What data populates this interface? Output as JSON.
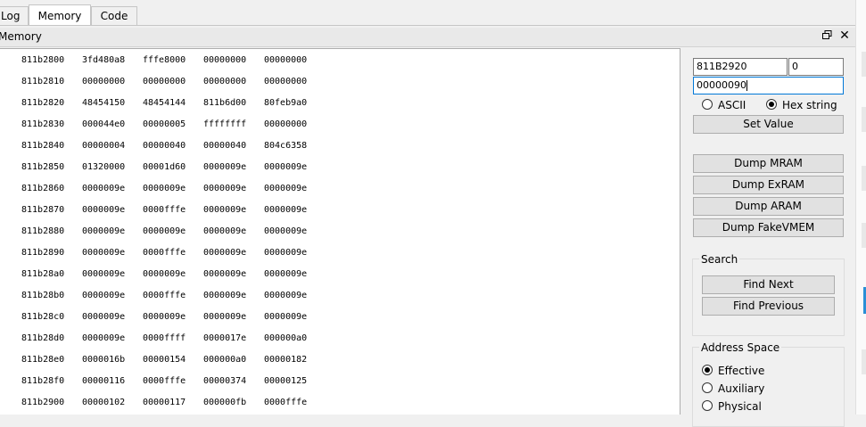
{
  "tabs": [
    {
      "label": "Log"
    },
    {
      "label": "Memory"
    },
    {
      "label": "Code"
    }
  ],
  "memory_panel": {
    "title": "Memory",
    "float_icon": "float-window-icon",
    "close_icon": "close-icon"
  },
  "hex_rows": [
    {
      "addr": "811b2800",
      "w": [
        "3fd480a8",
        "fffe8000",
        "00000000",
        "00000000"
      ]
    },
    {
      "addr": "811b2810",
      "w": [
        "00000000",
        "00000000",
        "00000000",
        "00000000"
      ]
    },
    {
      "addr": "811b2820",
      "w": [
        "48454150",
        "48454144",
        "811b6d00",
        "80feb9a0"
      ]
    },
    {
      "addr": "811b2830",
      "w": [
        "000044e0",
        "00000005",
        "ffffffff",
        "00000000"
      ]
    },
    {
      "addr": "811b2840",
      "w": [
        "00000004",
        "00000040",
        "00000040",
        "804c6358"
      ]
    },
    {
      "addr": "811b2850",
      "w": [
        "01320000",
        "00001d60",
        "0000009e",
        "0000009e"
      ]
    },
    {
      "addr": "811b2860",
      "w": [
        "0000009e",
        "0000009e",
        "0000009e",
        "0000009e"
      ]
    },
    {
      "addr": "811b2870",
      "w": [
        "0000009e",
        "0000fffe",
        "0000009e",
        "0000009e"
      ]
    },
    {
      "addr": "811b2880",
      "w": [
        "0000009e",
        "0000009e",
        "0000009e",
        "0000009e"
      ]
    },
    {
      "addr": "811b2890",
      "w": [
        "0000009e",
        "0000fffe",
        "0000009e",
        "0000009e"
      ]
    },
    {
      "addr": "811b28a0",
      "w": [
        "0000009e",
        "0000009e",
        "0000009e",
        "0000009e"
      ]
    },
    {
      "addr": "811b28b0",
      "w": [
        "0000009e",
        "0000fffe",
        "0000009e",
        "0000009e"
      ]
    },
    {
      "addr": "811b28c0",
      "w": [
        "0000009e",
        "0000009e",
        "0000009e",
        "0000009e"
      ]
    },
    {
      "addr": "811b28d0",
      "w": [
        "0000009e",
        "0000ffff",
        "0000017e",
        "000000a0"
      ]
    },
    {
      "addr": "811b28e0",
      "w": [
        "0000016b",
        "00000154",
        "000000a0",
        "00000182"
      ]
    },
    {
      "addr": "811b28f0",
      "w": [
        "00000116",
        "0000fffe",
        "00000374",
        "00000125"
      ]
    },
    {
      "addr": "811b2900",
      "w": [
        "00000102",
        "00000117",
        "000000fb",
        "0000fffe"
      ]
    }
  ],
  "controls": {
    "address_value": "811B2920",
    "length_value": "0",
    "value_input": "00000090",
    "radio_ascii": "ASCII",
    "radio_hex": "Hex string",
    "hex_selected": true,
    "set_value": "Set Value",
    "dump_mram": "Dump MRAM",
    "dump_exram": "Dump ExRAM",
    "dump_aram": "Dump ARAM",
    "dump_fakevmem": "Dump FakeVMEM"
  },
  "search": {
    "label": "Search",
    "find_next": "Find Next",
    "find_previous": "Find Previous"
  },
  "address_space": {
    "label": "Address Space",
    "options": [
      "Effective",
      "Auxiliary",
      "Physical"
    ],
    "selected": "Effective"
  }
}
